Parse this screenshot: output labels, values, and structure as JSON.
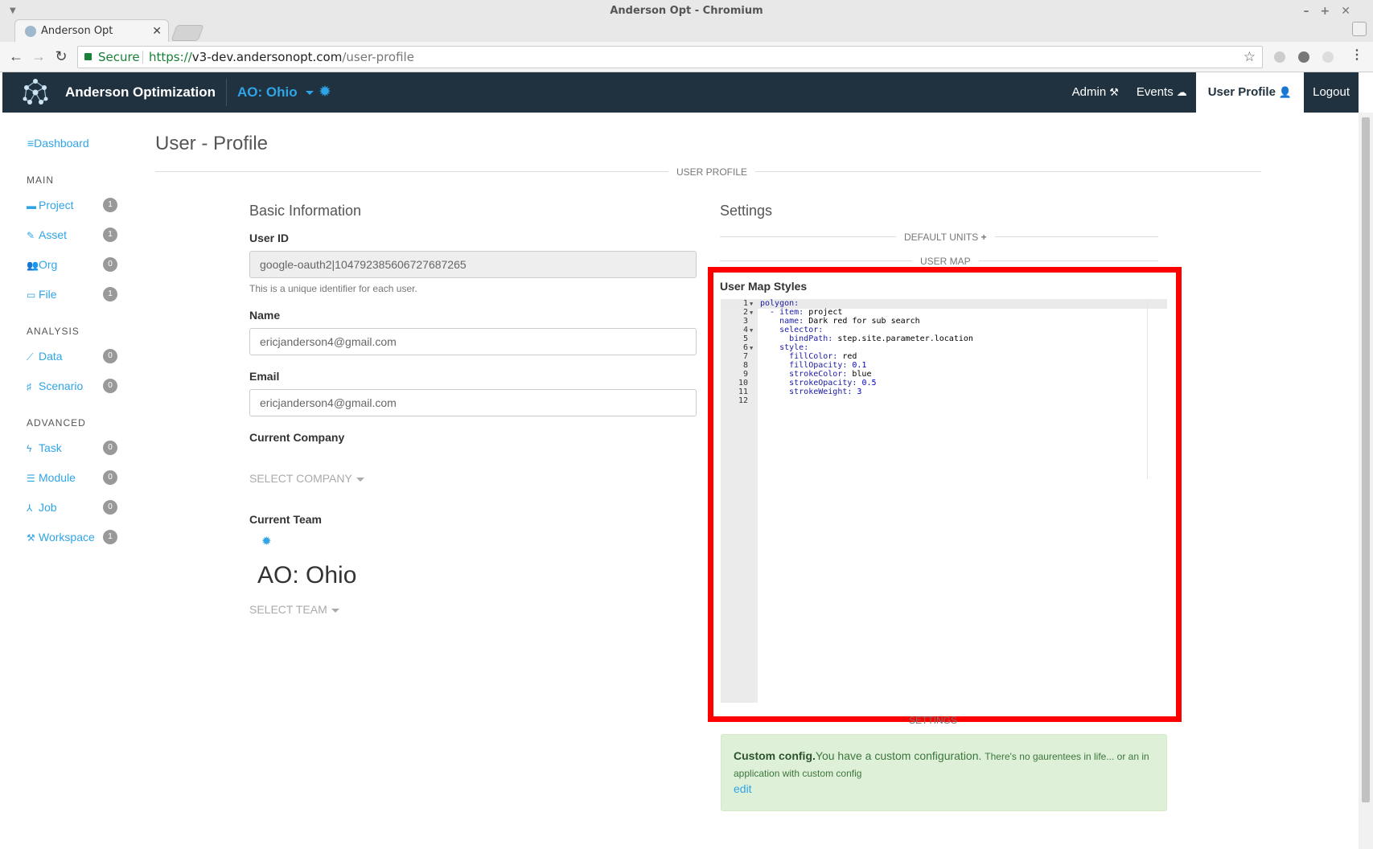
{
  "window": {
    "title": "Anderson Opt - Chromium"
  },
  "browser": {
    "tab_title": "Anderson Opt",
    "secure_label": "Secure",
    "url_scheme": "https://",
    "url_host": "v3-dev.andersonopt.com",
    "url_path": "/user-profile"
  },
  "navbar": {
    "brand": "Anderson Optimization",
    "team": "AO: Ohio",
    "links": [
      {
        "label": "Admin",
        "icon": "tools-icon"
      },
      {
        "label": "Events",
        "icon": "cloud-icon"
      },
      {
        "label": "User Profile",
        "icon": "user-icon"
      },
      {
        "label": "Logout",
        "icon": ""
      }
    ]
  },
  "sidebar": {
    "dashboard": "Dashboard",
    "sections": [
      {
        "title": "MAIN",
        "items": [
          {
            "label": "Project",
            "count": "1",
            "icon": "folder-icon"
          },
          {
            "label": "Asset",
            "count": "1",
            "icon": "pencil-icon"
          },
          {
            "label": "Org",
            "count": "0",
            "icon": "users-icon"
          },
          {
            "label": "File",
            "count": "1",
            "icon": "hdd-icon"
          }
        ]
      },
      {
        "title": "ANALYSIS",
        "items": [
          {
            "label": "Data",
            "count": "0",
            "icon": "chart-icon"
          },
          {
            "label": "Scenario",
            "count": "0",
            "icon": "sliders-icon"
          }
        ]
      },
      {
        "title": "ADVANCED",
        "items": [
          {
            "label": "Task",
            "count": "0",
            "icon": "bolt-icon"
          },
          {
            "label": "Module",
            "count": "0",
            "icon": "database-icon"
          },
          {
            "label": "Job",
            "count": "0",
            "icon": "sitemap-icon"
          },
          {
            "label": "Workspace",
            "count": "1",
            "icon": "wrench-icon"
          }
        ]
      }
    ]
  },
  "page": {
    "title": "User - Profile",
    "section_label": "USER PROFILE"
  },
  "basic": {
    "title": "Basic Information",
    "user_id_label": "User ID",
    "user_id_value": "google-oauth2|104792385606727687265",
    "user_id_help": "This is a unique identifier for each user.",
    "name_label": "Name",
    "name_value": "ericjanderson4@gmail.com",
    "email_label": "Email",
    "email_value": "ericjanderson4@gmail.com",
    "company_label": "Current Company",
    "company_select": "SELECT COMPANY",
    "team_label": "Current Team",
    "team_name": "AO: Ohio",
    "team_select": "SELECT TEAM"
  },
  "settings": {
    "title": "Settings",
    "default_units": "DEFAULT UNITS",
    "user_map": "USER MAP",
    "map_styles_label": "User Map Styles",
    "code_lines": [
      {
        "n": "1",
        "fold": true,
        "indent": 0,
        "key": "polygon:",
        "val": ""
      },
      {
        "n": "2",
        "fold": true,
        "indent": 1,
        "key": "- item:",
        "val": " project"
      },
      {
        "n": "3",
        "fold": false,
        "indent": 2,
        "key": "name:",
        "val": " Dark red for sub search"
      },
      {
        "n": "4",
        "fold": true,
        "indent": 2,
        "key": "selector:",
        "val": ""
      },
      {
        "n": "5",
        "fold": false,
        "indent": 3,
        "key": "bindPath:",
        "val": " step.site.parameter.location"
      },
      {
        "n": "6",
        "fold": true,
        "indent": 2,
        "key": "style:",
        "val": ""
      },
      {
        "n": "7",
        "fold": false,
        "indent": 3,
        "key": "fillColor:",
        "val": " red"
      },
      {
        "n": "8",
        "fold": false,
        "indent": 3,
        "key": "fillOpacity:",
        "val": " 0.1",
        "num": true
      },
      {
        "n": "9",
        "fold": false,
        "indent": 3,
        "key": "strokeColor:",
        "val": " blue"
      },
      {
        "n": "10",
        "fold": false,
        "indent": 3,
        "key": "strokeOpacity:",
        "val": " 0.5",
        "num": true
      },
      {
        "n": "11",
        "fold": false,
        "indent": 3,
        "key": "strokeWeight:",
        "val": " 3",
        "num": true
      },
      {
        "n": "12",
        "fold": false,
        "indent": 0,
        "key": "",
        "val": ""
      }
    ],
    "settings_sub": "SETTINGS"
  },
  "alert": {
    "strong": "Custom config.",
    "text": "You have a custom configuration.",
    "small": "There's no gaurentees in life... or an in application with custom config",
    "edit": "edit"
  },
  "colors": {
    "navbar_bg": "#20323f",
    "accent": "#2fa4e7",
    "highlight_box": "#ff0000",
    "alert_bg": "#dff0d8"
  }
}
